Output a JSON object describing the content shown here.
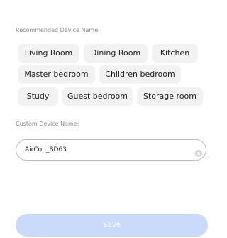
{
  "recommended": {
    "label": "Recommended Device Name:",
    "chips": [
      {
        "label": "Living Room"
      },
      {
        "label": "Dining Room"
      },
      {
        "label": "Kitchen"
      },
      {
        "label": "Master bedroom"
      },
      {
        "label": "Children bedroom"
      },
      {
        "label": "Study"
      },
      {
        "label": "Guest bedroom"
      },
      {
        "label": "Storage room"
      }
    ]
  },
  "custom": {
    "label": "Custom Device Name:",
    "value": "AirCon_BD63",
    "clear_icon": "clear-circle-icon"
  },
  "save": {
    "label": "Save",
    "enabled": false,
    "color": "#c9dafb"
  }
}
